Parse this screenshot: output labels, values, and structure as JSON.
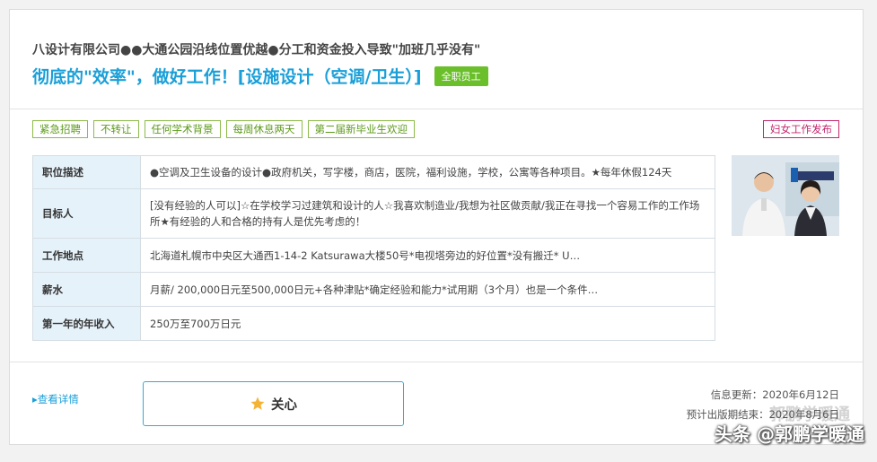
{
  "header": {
    "company": "八设计有限公司●●大通公园沿线位置优越●分工和资金投入导致\"加班几乎没有\"",
    "job_title": "彻底的\"效率\"，做好工作！[设施设计（空调/卫生）]",
    "employment_badge": "全职员工"
  },
  "tags": [
    "紧急招聘",
    "不转让",
    "任何学术背景",
    "每周休息两天",
    "第二届新毕业生欢迎"
  ],
  "women_tag": "妇女工作发布",
  "details": [
    {
      "label": "职位描述",
      "value": "●空调及卫生设备的设计●政府机关，写字楼，商店，医院，福利设施，学校，公寓等各种项目。★每年休假124天"
    },
    {
      "label": "目标人",
      "value": "[没有经验的人可以]☆在学校学习过建筑和设计的人☆我喜欢制造业/我想为社区做贡献/我正在寻找一个容易工作的工作场所★有经验的人和合格的持有人是优先考虑的！"
    },
    {
      "label": "工作地点",
      "value": "北海道札幌市中央区大通西1-14-2 Katsurawa大楼50号*电视塔旁边的好位置*没有搬迁* U…"
    },
    {
      "label": "薪水",
      "value": "月薪/ 200,000日元至500,000日元+各种津贴*确定经验和能力*试用期（3个月）也是一个条件…"
    },
    {
      "label": "第一年的年收入",
      "value": "250万至700万日元"
    }
  ],
  "footer": {
    "view_details": "▸查看详情",
    "favorite_label": "关心",
    "updated": "信息更新：2020年6月12日",
    "expected_end": "预计出版期结束：2020年8月6日",
    "faint_watermark": "郭鹏学暖通",
    "watermark": "头条 @郭鹏学暖通"
  },
  "colors": {
    "accent": "#1a9fd8",
    "tag_green": "#5c9a1a",
    "badge_green": "#6abf2a",
    "women_tag": "#c2276f",
    "table_header_bg": "#e6f2fa"
  }
}
